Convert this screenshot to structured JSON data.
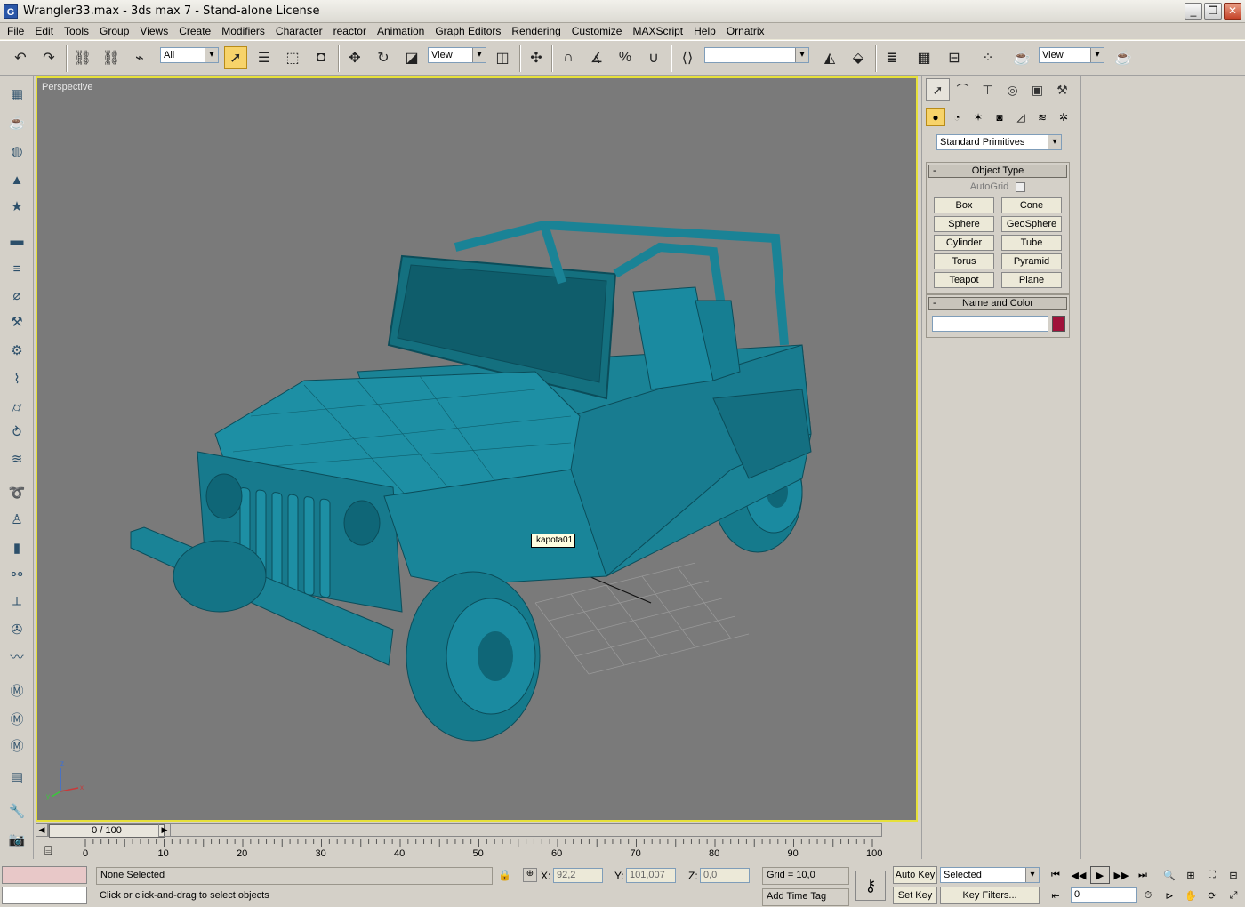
{
  "window": {
    "title": "Wrangler33.max - 3ds max 7  - Stand-alone License",
    "app_icon": "3ds-max-icon"
  },
  "menu": [
    "File",
    "Edit",
    "Tools",
    "Group",
    "Views",
    "Create",
    "Modifiers",
    "Character",
    "reactor",
    "Animation",
    "Graph Editors",
    "Rendering",
    "Customize",
    "MAXScript",
    "Help",
    "Ornatrix"
  ],
  "toolbar": {
    "selection_filter": "All",
    "ref_coord": "View",
    "named_selection": "",
    "render_type": "View"
  },
  "viewport": {
    "label": "Perspective",
    "tooltip": "kapota01",
    "object_color": "#1b8aa0",
    "axis": {
      "x": "x",
      "y": "y",
      "z": "z"
    }
  },
  "command_panel": {
    "category": "Standard Primitives",
    "object_type": {
      "title": "Object Type",
      "autogrid": "AutoGrid",
      "buttons": [
        "Box",
        "Cone",
        "Sphere",
        "GeoSphere",
        "Cylinder",
        "Tube",
        "Torus",
        "Pyramid",
        "Teapot",
        "Plane"
      ]
    },
    "name_color": {
      "title": "Name and Color",
      "name_value": "",
      "color": "#a0123a"
    }
  },
  "time_slider": {
    "label": "0 / 100"
  },
  "track": {
    "ticks": [
      "0",
      "10",
      "20",
      "30",
      "40",
      "50",
      "60",
      "70",
      "80",
      "90",
      "100"
    ]
  },
  "status": {
    "selection": "None Selected",
    "prompt": "Click or click-and-drag to select objects",
    "x_label": "X:",
    "x_value": "92,2",
    "y_label": "Y:",
    "y_value": "101,007",
    "z_label": "Z:",
    "z_value": "0,0",
    "grid": "Grid = 10,0",
    "add_time_tag": "Add Time Tag",
    "auto_key": "Auto Key",
    "set_key": "Set Key",
    "key_filter_mode": "Selected",
    "key_filters": "Key Filters...",
    "current_frame": "0"
  }
}
